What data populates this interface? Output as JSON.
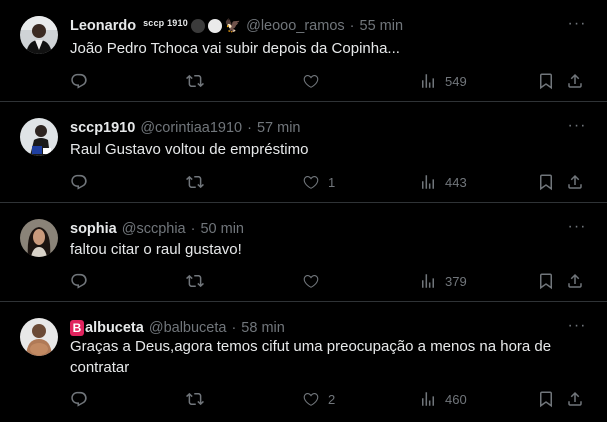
{
  "posts": [
    {
      "name": "Leonardo",
      "badge_text": "sccp 1910",
      "badge_emoji": "🦅",
      "handle": "@leooo_ramos",
      "time": "55 min",
      "text": "João Pedro Tchoca vai subir depois da Copinha...",
      "likes": "",
      "views": "549"
    },
    {
      "name": "sccp1910",
      "handle": "@corintiaa1910",
      "time": "57 min",
      "text": "Raul Gustavo voltou de empréstimo",
      "likes": "1",
      "views": "443"
    },
    {
      "name": "sophia",
      "handle": "@sccphia",
      "time": "50 min",
      "text": "faltou citar o raul gustavo!",
      "likes": "",
      "views": "379"
    },
    {
      "name": "albuceta",
      "name_badge": "B",
      "handle": "@balbuceta",
      "time": "58 min",
      "text": "Graças a Deus,agora temos cifut uma preocupação a menos na hora de contratar",
      "likes": "2",
      "views": "460"
    }
  ],
  "separator": "·",
  "more_glyph": "···",
  "colors": {
    "background": "#000000",
    "text": "#e7e9ea",
    "muted": "#71767b",
    "divider": "#2f3336",
    "name_badge": "#e0245e"
  },
  "icons": [
    "reply-icon",
    "repost-icon",
    "like-icon",
    "views-icon",
    "bookmark-icon",
    "share-icon",
    "more-icon"
  ]
}
